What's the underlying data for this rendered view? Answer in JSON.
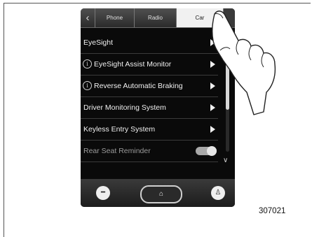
{
  "tabs": {
    "back_icon": "chevron-left-icon",
    "items": [
      "Phone",
      "Radio",
      "Car"
    ],
    "active": "Car"
  },
  "menu": {
    "items": [
      {
        "label": "EyeSight",
        "info": false,
        "control": "arrow"
      },
      {
        "label": "EyeSight Assist Monitor",
        "info": true,
        "control": "arrow"
      },
      {
        "label": "Reverse Automatic Braking",
        "info": true,
        "control": "arrow"
      },
      {
        "label": "Driver Monitoring System",
        "info": false,
        "control": "arrow"
      },
      {
        "label": "Keyless Entry System",
        "info": false,
        "control": "arrow"
      },
      {
        "label": "Rear Seat Reminder",
        "info": false,
        "control": "toggle",
        "toggle_on": true
      }
    ],
    "info_glyph": "i"
  },
  "bottom": {
    "left_icon": "minus-circle-icon",
    "home_icon": "home-icon",
    "right_icon": "person-icon"
  },
  "reference_code": "307021"
}
